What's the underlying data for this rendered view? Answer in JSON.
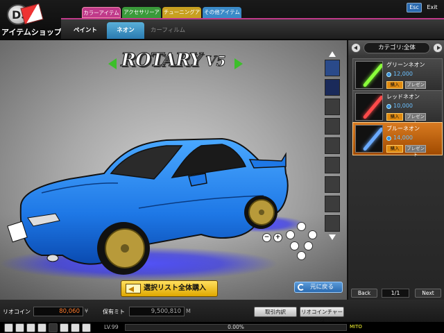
{
  "header": {
    "logo_letter": "DS",
    "shop_title": "アイテムショップ",
    "category_tabs": [
      "カラーアイテム",
      "アクセサリーアイテム",
      "チューニングアイテム",
      "その他アイテム"
    ],
    "sub_tabs": [
      "ペイント",
      "ネオン",
      "カーフィルム"
    ],
    "esc_label": "Esc",
    "exit_label": "Exit"
  },
  "car": {
    "name": "ROTARY",
    "version": "V5",
    "body_color": "#1e78e6",
    "neon_color": "#3a3aff",
    "wheel_color": "#b89a3a"
  },
  "controls": {
    "buy_all_label": "選択リスト全体購入",
    "revert_label": "元に戻る",
    "zoom_out": "−",
    "zoom_in": "+"
  },
  "panel": {
    "title": "カテゴリ:全体",
    "items": [
      {
        "name": "グリーンネオン",
        "price": "12,000",
        "buy": "購入",
        "gift": "プレゼント",
        "color": "#8aff3a"
      },
      {
        "name": "レッドネオン",
        "price": "10,000",
        "buy": "購入",
        "gift": "プレゼント",
        "color": "#ff4a4a"
      },
      {
        "name": "ブルーネオン",
        "price": "14,000",
        "buy": "購入",
        "gift": "プレゼント",
        "color": "#6aaaff"
      }
    ],
    "pager": {
      "back": "Back",
      "page": "1/1",
      "next": "Next"
    }
  },
  "footer": {
    "rio_coin_label": "リオコイン",
    "rio_coin_value": "80,060",
    "rio_coin_unit": "¥",
    "held_mito_label": "保有ミト",
    "held_mito_value": "9,500,810",
    "held_mito_unit": "M",
    "history_label": "取引内訳",
    "charge_label": "リオコインチャージ",
    "level": "LV.99",
    "exp_percent": "0.00%",
    "mito_badge": "MITO"
  }
}
